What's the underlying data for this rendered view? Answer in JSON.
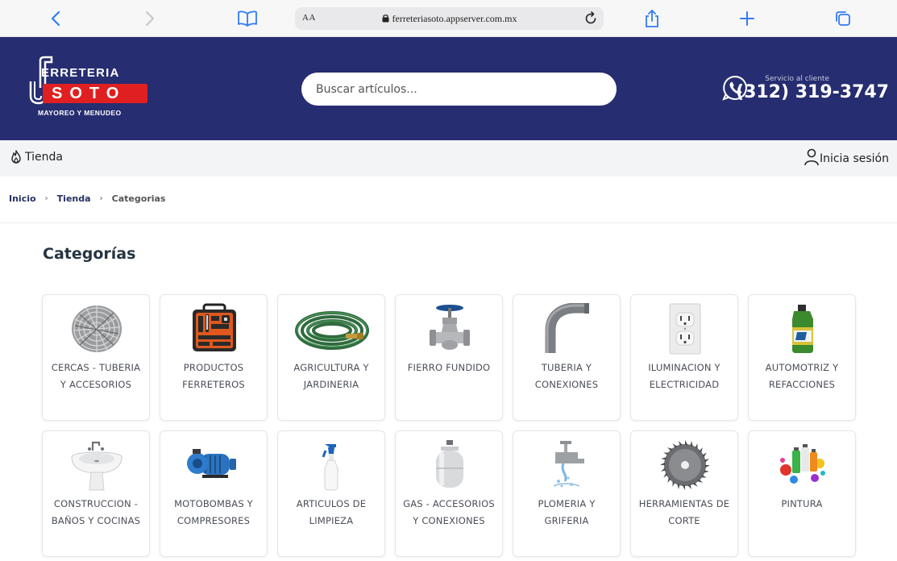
{
  "browser": {
    "text_size_label": "AA",
    "url": "ferreteriasoto.appserver.com.mx",
    "icons": [
      "back-icon",
      "forward-icon",
      "bookmarks-icon",
      "lock-icon",
      "reload-icon",
      "share-icon",
      "new-tab-icon",
      "tabs-icon"
    ]
  },
  "header": {
    "logo": {
      "top": "ERRETERIA",
      "main": "SOTO",
      "tagline": "MAYOREO Y MENUDEO"
    },
    "search_placeholder": "Buscar artículos...",
    "support_label": "Servicio al cliente",
    "support_phone": "(312) 319-3747",
    "colors": {
      "header_bg": "#262d70",
      "logo_red": "#e02020"
    }
  },
  "subnav": {
    "store_label": "Tienda",
    "login_label": "Inicia sesión"
  },
  "breadcrumb": {
    "home": "Inicio",
    "store": "Tienda",
    "current": "Categorias",
    "separator": "›"
  },
  "page_title": "Categorías",
  "categories": [
    {
      "label": "CERCAS - TUBERIA Y ACCESORIOS",
      "icon": "barbed-wire-icon"
    },
    {
      "label": "PRODUCTOS FERRETEROS",
      "icon": "toolbox-icon"
    },
    {
      "label": "AGRICULTURA Y JARDINERIA",
      "icon": "garden-hose-icon"
    },
    {
      "label": "FIERRO FUNDIDO",
      "icon": "gate-valve-icon"
    },
    {
      "label": "TUBERIA Y CONEXIONES",
      "icon": "pipe-elbow-icon"
    },
    {
      "label": "ILUMINACION Y ELECTRICIDAD",
      "icon": "wall-outlet-icon"
    },
    {
      "label": "AUTOMOTRIZ Y REFACCIONES",
      "icon": "oil-bottle-icon"
    },
    {
      "label": "CONSTRUCCION - BAÑOS Y COCINAS",
      "icon": "sink-icon"
    },
    {
      "label": "MOTOBOMBAS Y COMPRESORES",
      "icon": "water-pump-icon"
    },
    {
      "label": "ARTICULOS DE LIMPIEZA",
      "icon": "spray-bottle-icon"
    },
    {
      "label": "GAS - ACCESORIOS Y CONEXIONES",
      "icon": "gas-tank-icon"
    },
    {
      "label": "PLOMERIA Y GRIFERIA",
      "icon": "faucet-icon"
    },
    {
      "label": "HERRAMIENTAS DE CORTE",
      "icon": "saw-blade-icon"
    },
    {
      "label": "PINTURA",
      "icon": "spray-paint-icon"
    }
  ]
}
